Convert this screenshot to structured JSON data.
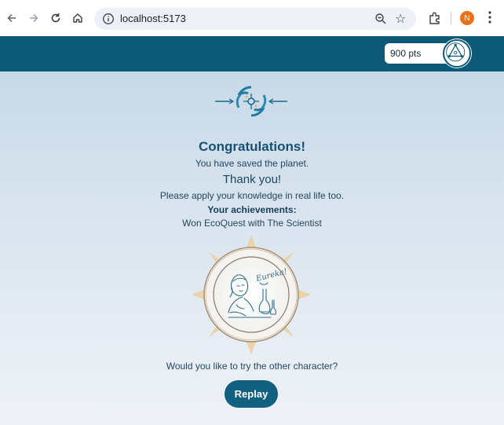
{
  "browser": {
    "url": "localhost:5173",
    "profile_initial": "N"
  },
  "app": {
    "points": "900 pts"
  },
  "main": {
    "title": "Congratulations!",
    "subtitle": "You have saved the planet.",
    "thanks": "Thank you!",
    "apply_text": "Please apply your knowledge in real life too.",
    "achievements_heading": "Your achievements:",
    "achievements": [
      "Won EcoQuest with The Scientist"
    ],
    "badge_caption": "Eureka!",
    "question": "Would you like to try the other character?",
    "replay_label": "Replay"
  },
  "colors": {
    "header": "#0c5a78",
    "accent": "#155170",
    "button": "#11607f"
  }
}
